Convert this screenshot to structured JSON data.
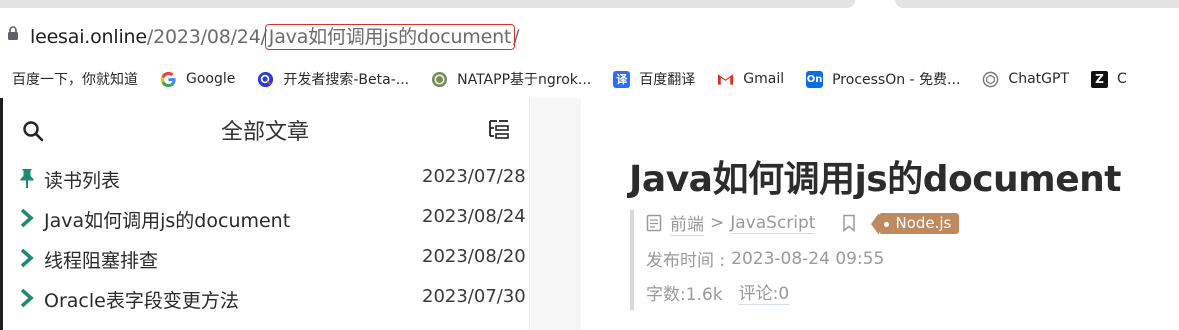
{
  "address_bar": {
    "host": "leesai.online",
    "path_prefix": "/2023/08/24/",
    "path_highlight": "Java如何调用js的document",
    "path_suffix": "/"
  },
  "bookmarks": [
    {
      "label": "百度一下，你就知道",
      "icon": "none"
    },
    {
      "label": "Google",
      "icon": "google-icon"
    },
    {
      "label": "开发者搜索-Beta-...",
      "icon": "dev-search-icon"
    },
    {
      "label": "NATAPP基于ngrok...",
      "icon": "natapp-icon"
    },
    {
      "label": "百度翻译",
      "icon": "baidu-translate-icon"
    },
    {
      "label": "Gmail",
      "icon": "gmail-icon"
    },
    {
      "label": "ProcessOn - 免费...",
      "icon": "processon-icon"
    },
    {
      "label": "ChatGPT",
      "icon": "chatgpt-icon"
    },
    {
      "label": "C",
      "icon": "z-icon"
    }
  ],
  "sidebar": {
    "title": "全部文章",
    "articles": [
      {
        "title": "读书列表",
        "date": "2023/07/28",
        "pinned": true
      },
      {
        "title": "Java如何调用js的document",
        "date": "2023/08/24",
        "pinned": false
      },
      {
        "title": "线程阻塞排查",
        "date": "2023/08/20",
        "pinned": false
      },
      {
        "title": "Oracle表字段变更方法",
        "date": "2023/07/30",
        "pinned": false
      }
    ]
  },
  "post": {
    "title": "Java如何调用js的document",
    "category_1": "前端",
    "category_sep": ">",
    "category_2": "JavaScript",
    "tag": "Node.js",
    "publish_label": "发布时间 :",
    "publish_time": "2023-08-24 09:55",
    "word_count_label": "字数:1.6k",
    "comments_label": "评论:0"
  },
  "colors": {
    "accent_teal": "#1f8a70",
    "tag_brown": "#bf8a60",
    "highlight_red": "#d9302c"
  }
}
